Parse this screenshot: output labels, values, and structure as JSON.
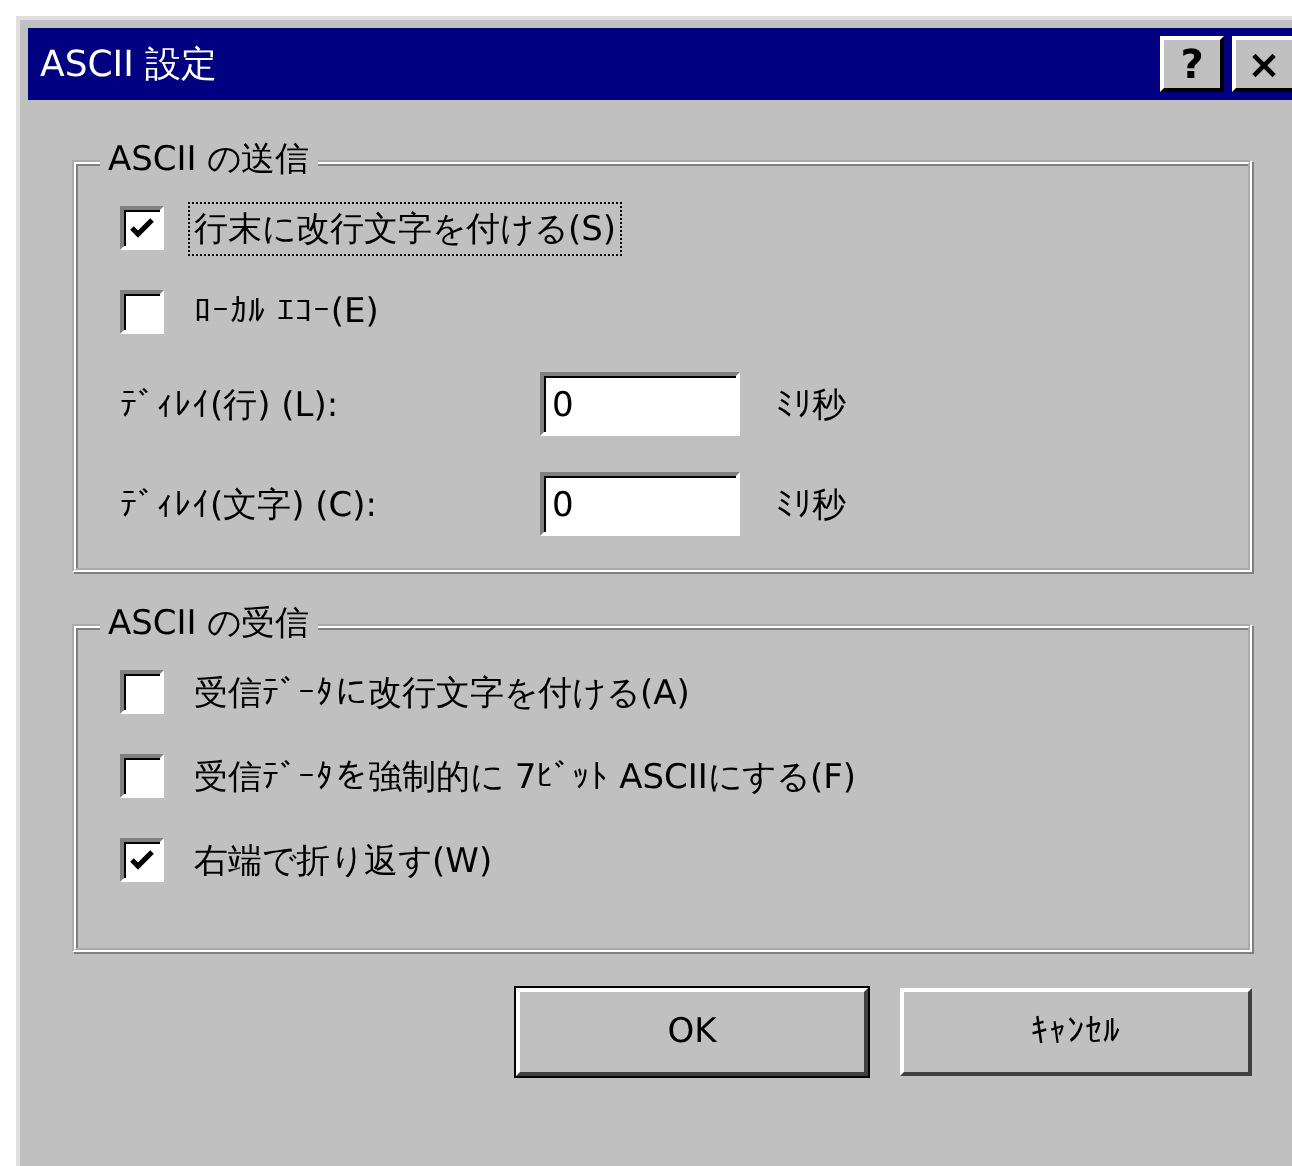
{
  "window": {
    "title": "ASCII 設定",
    "title_buttons": [
      "?",
      "×"
    ]
  },
  "groups": [
    {
      "title": "ASCII の送信",
      "items": [
        {
          "kind": "checkbox",
          "label": "行末に改行文字を付ける(S)",
          "checked": true,
          "focused": true
        },
        {
          "kind": "checkbox",
          "label": "ﾛｰｶﾙ ｴｺｰ(E)",
          "checked": false,
          "focused": false
        },
        {
          "kind": "field",
          "label": "ﾃﾞｨﾚｲ(行) (L):",
          "value": "0",
          "unit": "ﾐﾘ秒"
        },
        {
          "kind": "field",
          "label": "ﾃﾞｨﾚｲ(文字) (C):",
          "value": "0",
          "unit": "ﾐﾘ秒"
        }
      ]
    },
    {
      "title": "ASCII の受信",
      "items": [
        {
          "kind": "checkbox",
          "label": "受信ﾃﾞｰﾀに改行文字を付ける(A)",
          "checked": false,
          "focused": false
        },
        {
          "kind": "checkbox",
          "label": "受信ﾃﾞｰﾀを強制的に 7ﾋﾞｯﾄ ASCIIにする(F)",
          "checked": false,
          "focused": false
        },
        {
          "kind": "checkbox",
          "label": "右端で折り返す(W)",
          "checked": true,
          "focused": false
        }
      ]
    }
  ],
  "buttons": [
    {
      "label": "OK",
      "default": true
    },
    {
      "label": "ｷｬﾝｾﾙ",
      "default": false
    }
  ]
}
